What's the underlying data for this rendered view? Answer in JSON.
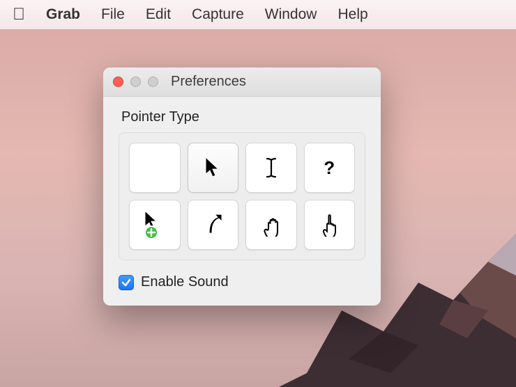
{
  "menubar": {
    "app_name": "Grab",
    "items": [
      "File",
      "Edit",
      "Capture",
      "Window",
      "Help"
    ]
  },
  "window": {
    "title": "Preferences",
    "section_label": "Pointer Type",
    "pointers": [
      {
        "id": "none",
        "name": "pointer-none",
        "selected": false
      },
      {
        "id": "arrow",
        "name": "pointer-arrow",
        "selected": true
      },
      {
        "id": "ibeam",
        "name": "pointer-ibeam",
        "selected": false
      },
      {
        "id": "help",
        "name": "pointer-help",
        "selected": false
      },
      {
        "id": "copy",
        "name": "pointer-copy",
        "selected": false
      },
      {
        "id": "alias",
        "name": "pointer-alias",
        "selected": false
      },
      {
        "id": "open-hand",
        "name": "pointer-open-hand",
        "selected": false
      },
      {
        "id": "pointing-hand",
        "name": "pointer-pointing-hand",
        "selected": false
      }
    ],
    "enable_sound": {
      "label": "Enable Sound",
      "checked": true
    }
  }
}
